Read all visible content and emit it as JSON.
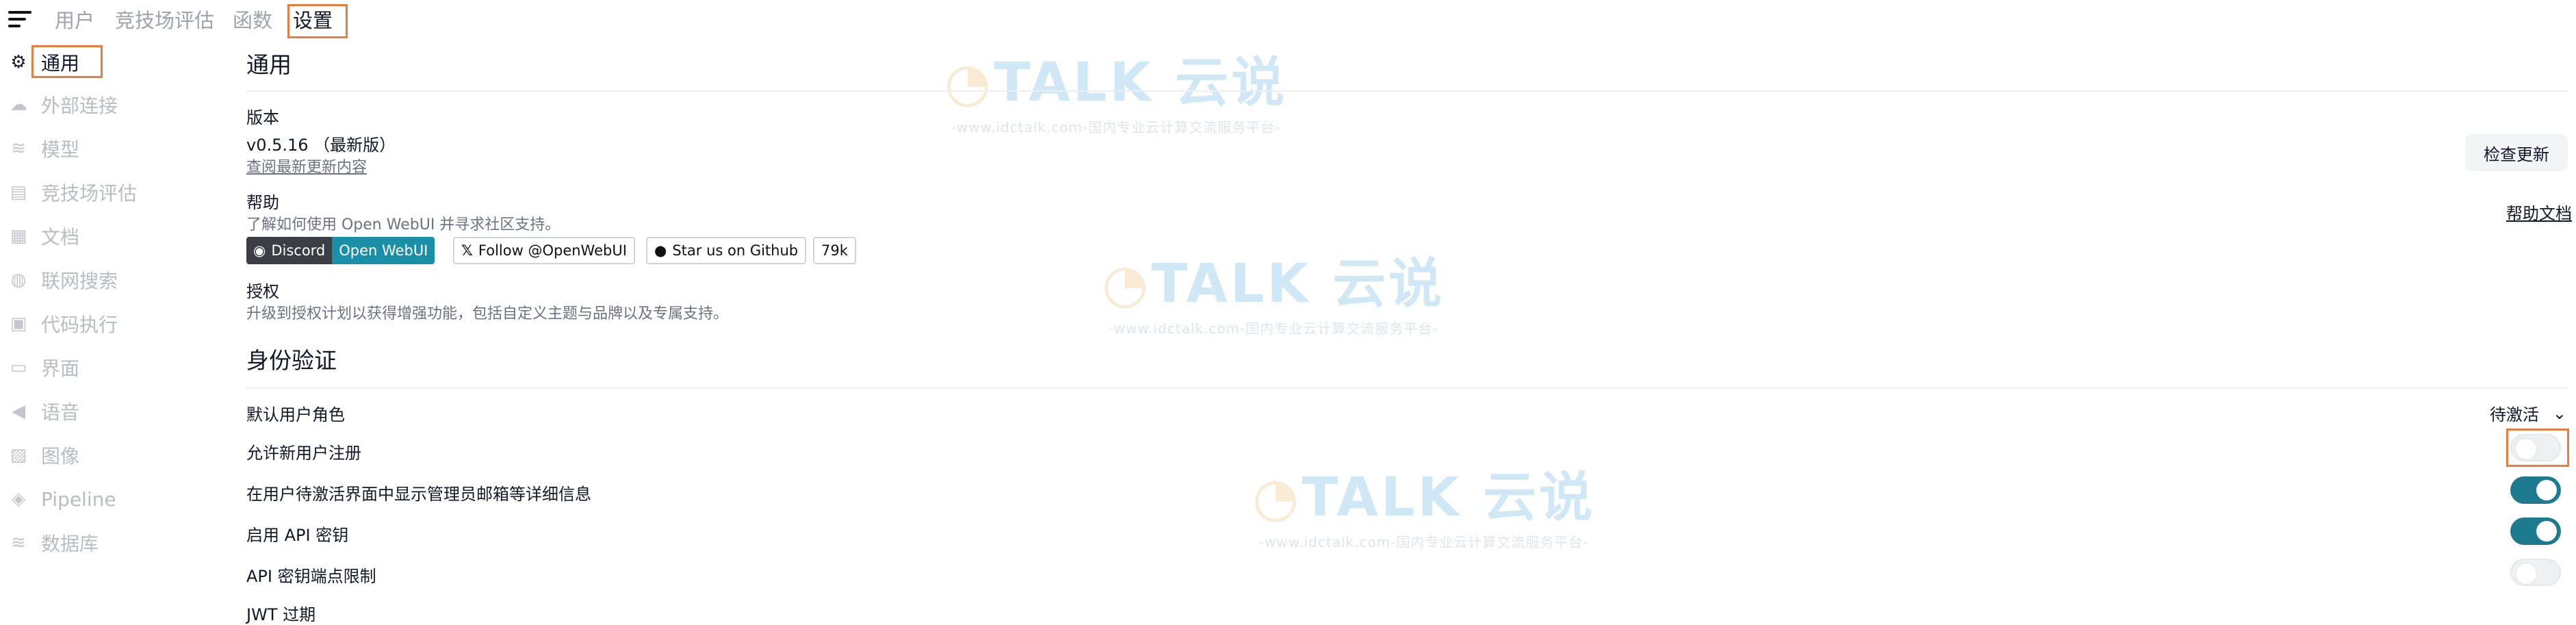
{
  "topnav": {
    "tabs": [
      {
        "label": "用户"
      },
      {
        "label": "竞技场评估"
      },
      {
        "label": "函数"
      },
      {
        "label": "设置"
      }
    ]
  },
  "sidebar": {
    "items": [
      {
        "label": "通用",
        "icon": "gear-icon"
      },
      {
        "label": "外部连接",
        "icon": "cloud-icon"
      },
      {
        "label": "模型",
        "icon": "database-icon"
      },
      {
        "label": "竞技场评估",
        "icon": "document-icon"
      },
      {
        "label": "文档",
        "icon": "file-icon"
      },
      {
        "label": "联网搜索",
        "icon": "globe-icon"
      },
      {
        "label": "代码执行",
        "icon": "terminal-icon"
      },
      {
        "label": "界面",
        "icon": "monitor-icon"
      },
      {
        "label": "语音",
        "icon": "speaker-icon"
      },
      {
        "label": "图像",
        "icon": "image-icon"
      },
      {
        "label": "Pipeline",
        "icon": "layers-icon"
      },
      {
        "label": "数据库",
        "icon": "database-icon"
      }
    ]
  },
  "general": {
    "title": "通用",
    "version_label": "版本",
    "version_value": "v0.5.16 （最新版）",
    "changelog_link": "查阅最新更新内容",
    "check_update_button": "检查更新",
    "help_label": "帮助",
    "help_desc": "了解如何使用 Open WebUI 并寻求社区支持。",
    "help_docs_link": "帮助文档",
    "badges": {
      "discord_left": "Discord",
      "discord_right": "Open WebUI",
      "twitter": "Follow @OpenWebUI",
      "github": "Star us on Github",
      "stars": "79k"
    },
    "license_label": "授权",
    "license_desc": "升级到授权计划以获得增强功能，包括自定义主题与品牌以及专属支持。"
  },
  "auth": {
    "title": "身份验证",
    "default_role_label": "默认用户角色",
    "default_role_value": "待激活",
    "rows": [
      {
        "label": "允许新用户注册",
        "on": false
      },
      {
        "label": "在用户待激活界面中显示管理员邮箱等详细信息",
        "on": true
      },
      {
        "label": "启用 API 密钥",
        "on": true
      },
      {
        "label": "API 密钥端点限制",
        "on": false
      }
    ],
    "jwt_label": "JWT 过期"
  },
  "watermark": {
    "brand_left": "TALK",
    "brand_right": "云说",
    "tagline": "-www.idctalk.com-国内专业云计算交流服务平台-"
  },
  "colors": {
    "accent": "#1e7a8f",
    "highlight": "#ea7c3e"
  }
}
